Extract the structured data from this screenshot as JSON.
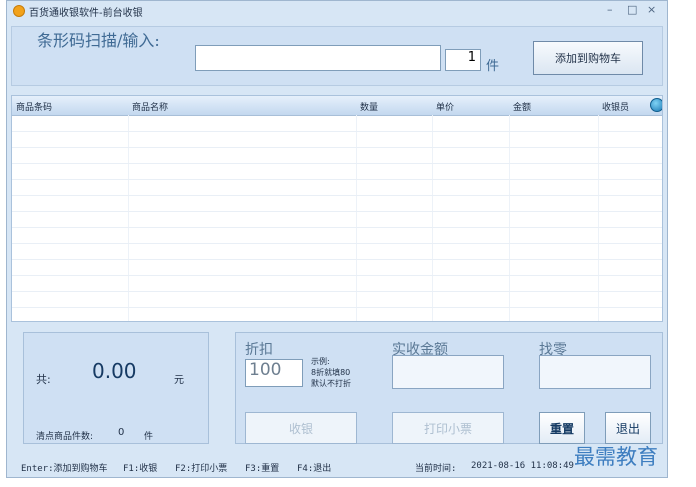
{
  "window": {
    "title": "百货通收银软件-前台收银",
    "controls": [
      "–",
      "□",
      "×"
    ]
  },
  "scan": {
    "label": "条形码扫描/输入:",
    "barcode_value": "",
    "qty_value": "1",
    "qty_unit": "件",
    "add_button": "添加到购物车"
  },
  "table": {
    "headers": [
      "商品条码",
      "商品名称",
      "数量",
      "单价",
      "金额",
      "收银员"
    ],
    "rows": [],
    "refresh_icon": "refresh-icon"
  },
  "summary": {
    "total_label": "共:",
    "total_value": "0.00",
    "total_unit": "元",
    "count_label": "清点商品件数:",
    "count_value": "0",
    "count_unit": "件"
  },
  "payment": {
    "discount_label": "折扣",
    "discount_value": "100",
    "discount_hint": [
      "示例:",
      "8折就填80",
      "默认不打折"
    ],
    "received_label": "实收金额",
    "received_value": "",
    "change_label": "找零",
    "change_value": ""
  },
  "buttons": {
    "checkout": "收银",
    "print_receipt": "打印小票",
    "reset": "重置",
    "exit": "退出"
  },
  "status_bar": {
    "shortcut_enter": "Enter:添加到购物车",
    "shortcut_f1": "F1:收银",
    "shortcut_f2": "F2:打印小票",
    "shortcut_f3": "F3:重置",
    "shortcut_f4": "F4:退出",
    "time_label": "当前时间:",
    "time_value": "2021-08-16 11:08:49"
  },
  "watermark": "最需教育"
}
